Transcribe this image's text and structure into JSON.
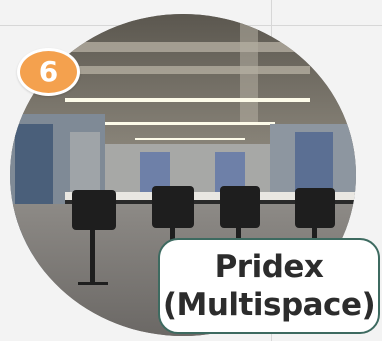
{
  "badge": {
    "number": "6",
    "color": "#f4a14e"
  },
  "label": {
    "line1": "Pridex",
    "line2": "(Multispace)",
    "border_color": "#3d6a60"
  },
  "photo": {
    "subject": "office-multispace-interior"
  }
}
